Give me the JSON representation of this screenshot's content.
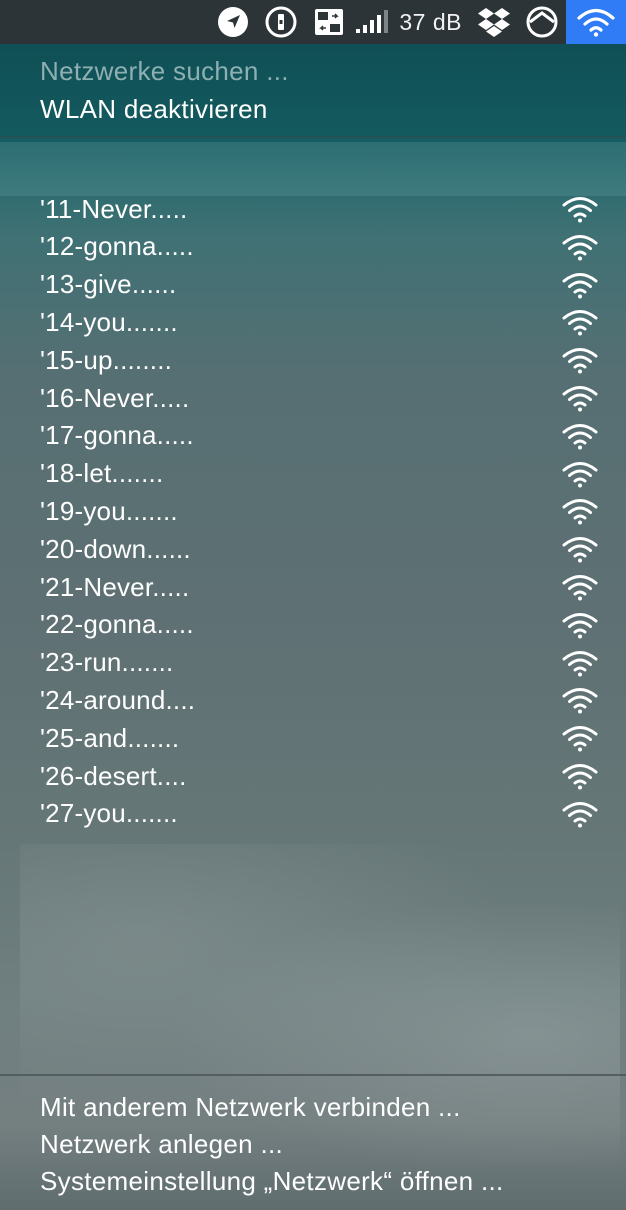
{
  "menubar": {
    "icons": [
      "location-arrow-icon",
      "password-manager-icon",
      "display-switch-icon",
      "signal-bars-icon",
      "dropbox-icon",
      "time-machine-icon",
      "wifi-icon"
    ],
    "db_label": "37 dB",
    "wifi_highlight_color": "#2f7cf6"
  },
  "menu": {
    "searching": "Netzwerke suchen ...",
    "disable_wifi": "WLAN deaktivieren"
  },
  "networks": [
    {
      "name": "'11-Never....."
    },
    {
      "name": "'12-gonna....."
    },
    {
      "name": "'13-give......"
    },
    {
      "name": "'14-you......."
    },
    {
      "name": "'15-up........"
    },
    {
      "name": "'16-Never....."
    },
    {
      "name": "'17-gonna....."
    },
    {
      "name": "'18-let......."
    },
    {
      "name": "'19-you......."
    },
    {
      "name": "'20-down......"
    },
    {
      "name": "'21-Never....."
    },
    {
      "name": "'22-gonna....."
    },
    {
      "name": "'23-run......."
    },
    {
      "name": "'24-around...."
    },
    {
      "name": "'25-and......."
    },
    {
      "name": "'26-desert...."
    },
    {
      "name": "'27-you......."
    }
  ],
  "footer": {
    "connect_other": "Mit anderem Netzwerk verbinden ...",
    "create_network": "Netzwerk anlegen ...",
    "open_prefs": "Systemeinstellung „Netzwerk“ öffnen ..."
  }
}
